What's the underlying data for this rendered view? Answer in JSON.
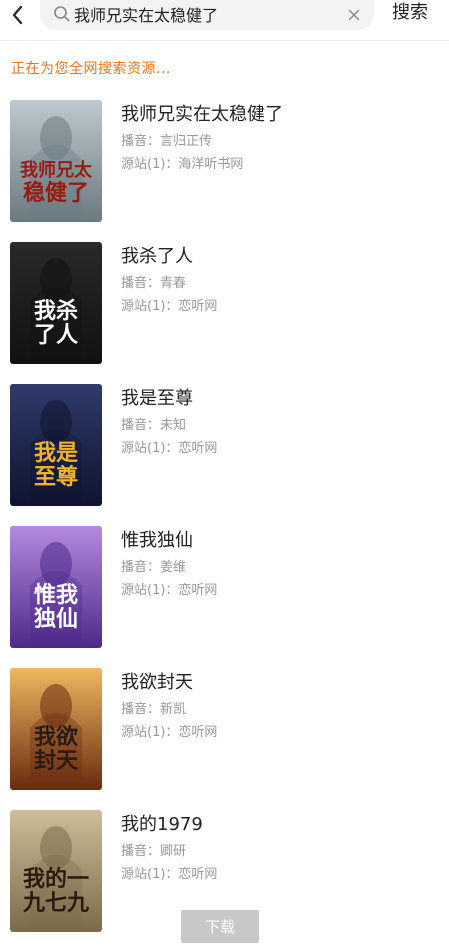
{
  "header": {
    "search_value": "我师兄实在太稳健了",
    "search_button": "搜索"
  },
  "status_text": "正在为您全网搜索资源...",
  "results": [
    {
      "title": "我师兄实在太稳健了",
      "narrator": "播音：言归正传",
      "source": "源站(1)：海洋听书网",
      "cover_text": "我师兄太稳健了",
      "cover_colors": [
        "#bfc9cf",
        "#6a7a80",
        "#9a1b12"
      ]
    },
    {
      "title": "我杀了人",
      "narrator": "播音：青春",
      "source": "源站(1)：恋听网",
      "cover_text": "我杀了人",
      "cover_colors": [
        "#2a2a2a",
        "#111111",
        "#ffffff"
      ]
    },
    {
      "title": "我是至尊",
      "narrator": "播音：未知",
      "source": "源站(1)：恋听网",
      "cover_text": "我是至尊",
      "cover_colors": [
        "#2f3b6a",
        "#0f1430",
        "#f0b429"
      ]
    },
    {
      "title": "惟我独仙",
      "narrator": "播音：姜维",
      "source": "源站(1)：恋听网",
      "cover_text": "惟我独仙",
      "cover_colors": [
        "#b48ae0",
        "#4d2a8a",
        "#ffffff"
      ]
    },
    {
      "title": "我欲封天",
      "narrator": "播音：新凯",
      "source": "源站(1)：恋听网",
      "cover_text": "我欲封天",
      "cover_colors": [
        "#f0b860",
        "#6a2a10",
        "#2a1a10"
      ]
    },
    {
      "title": "我的1979",
      "narrator": "播音：卿研",
      "source": "源站(1)：恋听网",
      "cover_text": "我的一九七九",
      "cover_colors": [
        "#cdbf9a",
        "#7a6a4a",
        "#2a1a10"
      ]
    }
  ],
  "download_label": "下载"
}
